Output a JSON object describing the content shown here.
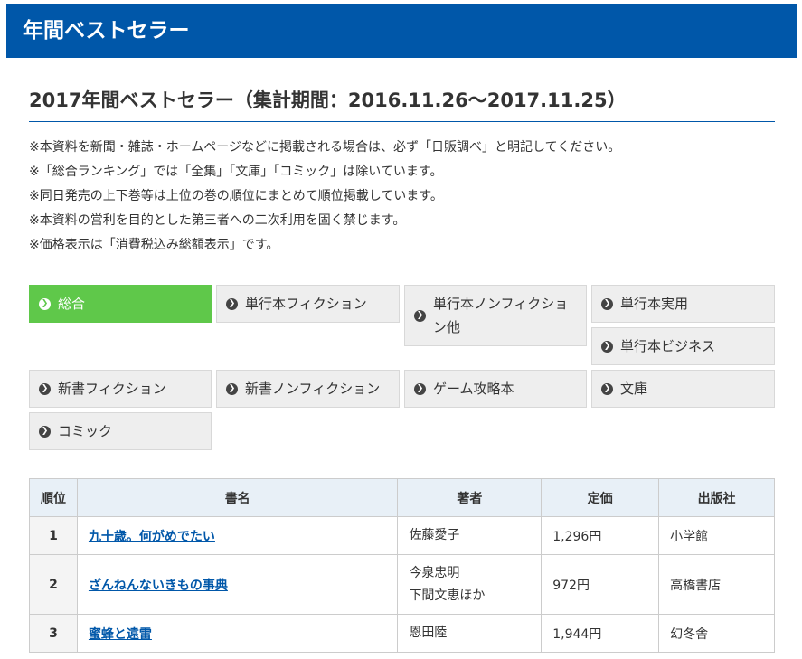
{
  "header": {
    "title": "年間ベストセラー"
  },
  "page_title": "2017年間ベストセラー（集計期間：2016.11.26〜2017.11.25）",
  "notes": [
    "※本資料を新聞・雑誌・ホームページなどに掲載される場合は、必ず「日販調べ」と明記してください。",
    "※「総合ランキング」では「全集」「文庫」「コミック」は除いています。",
    "※同日発売の上下巻等は上位の巻の順位にまとめて順位掲載しています。",
    "※本資料の営利を目的とした第三者への二次利用を固く禁じます。",
    "※価格表示は「消費税込み総額表示」です。"
  ],
  "tabs": [
    {
      "label": "総合",
      "active": true
    },
    {
      "label": "単行本フィクション",
      "active": false
    },
    {
      "label": "単行本ノンフィクション他",
      "label_line1": "単行本ノンフィクショ",
      "label_line2": "ン他",
      "active": false
    },
    {
      "label": "単行本実用",
      "active": false
    },
    {
      "label": "単行本ビジネス",
      "active": false
    },
    {
      "label": "新書フィクション",
      "active": false
    },
    {
      "label": "新書ノンフィクション",
      "active": false
    },
    {
      "label": "ゲーム攻略本",
      "active": false
    },
    {
      "label": "文庫",
      "active": false
    },
    {
      "label": "コミック",
      "active": false
    }
  ],
  "table": {
    "headers": [
      "順位",
      "書名",
      "著者",
      "定価",
      "出版社"
    ],
    "rows": [
      {
        "rank": "1",
        "title": "九十歳。何がめでたい",
        "authors": [
          "佐藤愛子"
        ],
        "price": "1,296円",
        "publisher": "小学館"
      },
      {
        "rank": "2",
        "title": "ざんねんないきもの事典",
        "authors": [
          "今泉忠明",
          "下間文恵ほか"
        ],
        "price": "972円",
        "publisher": "高橋書店"
      },
      {
        "rank": "3",
        "title": "蜜蜂と遠雷",
        "authors": [
          "恩田陸"
        ],
        "price": "1,944円",
        "publisher": "幻冬舎"
      }
    ]
  },
  "colors": {
    "brand": "#0057a9",
    "active_tab": "#5fc84a",
    "tab_bg": "#eeeeee",
    "header_cell": "#e8f0f7"
  },
  "icons": {
    "tab_arrow": "chevron-right-circle-icon"
  }
}
